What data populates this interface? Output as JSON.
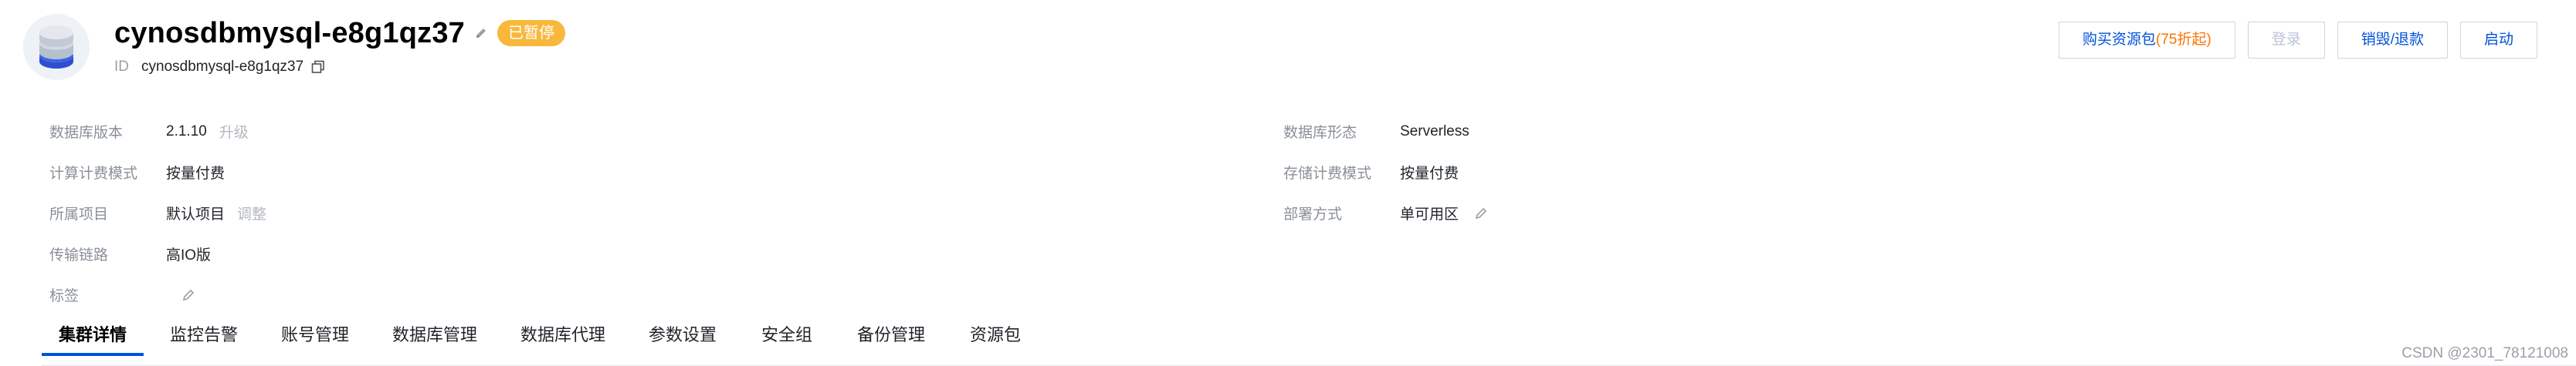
{
  "header": {
    "title": "cynosdbmysql-e8g1qz37",
    "status_badge": "已暂停",
    "id_label": "ID",
    "id_value": "cynosdbmysql-e8g1qz37"
  },
  "actions": {
    "buy_package_prefix": "购买资源包",
    "buy_package_highlight": "(75折起)",
    "login": "登录",
    "destroy": "销毁/退款",
    "start": "启动"
  },
  "info_left": [
    {
      "label": "数据库版本",
      "value": "2.1.10",
      "op": "升级"
    },
    {
      "label": "计算计费模式",
      "value": "按量付费"
    },
    {
      "label": "所属项目",
      "value": "默认项目",
      "op": "调整"
    },
    {
      "label": "传输链路",
      "value": "高IO版"
    },
    {
      "label": "标签",
      "value": ""
    }
  ],
  "info_right": [
    {
      "label": "数据库形态",
      "value": "Serverless"
    },
    {
      "label": "存储计费模式",
      "value": "按量付费"
    },
    {
      "label": "部署方式",
      "value": "单可用区"
    }
  ],
  "tabs": [
    "集群详情",
    "监控告警",
    "账号管理",
    "数据库管理",
    "数据库代理",
    "参数设置",
    "安全组",
    "备份管理",
    "资源包"
  ],
  "active_tab": "集群详情",
  "watermark": "CSDN @2301_78121008",
  "colors": {
    "accent": "#0052d9",
    "badge": "#f9b83b",
    "highlight": "#ff7200"
  },
  "icons": {
    "logo": "database-icon",
    "edit": "pencil-icon",
    "copy": "copy-icon"
  }
}
